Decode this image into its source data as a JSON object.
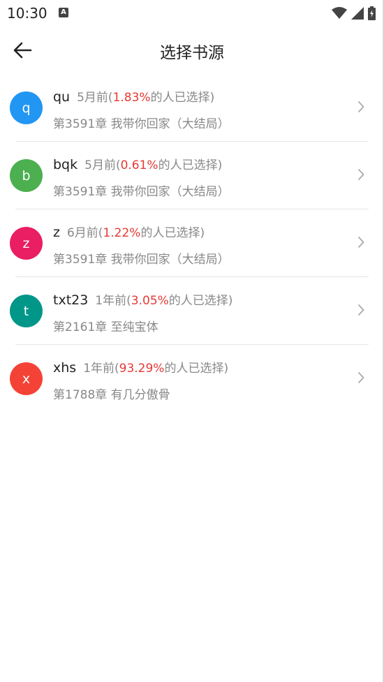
{
  "status_bar": {
    "time": "10:30",
    "notification_icon": "A"
  },
  "app_bar": {
    "title": "选择书源"
  },
  "sources": [
    {
      "letter": "q",
      "name": "qu",
      "age": "5月前(",
      "percent": "1.83%",
      "suffix": "的人已选择)",
      "chapter": "第3591章 我带你回家（大结局）",
      "avatar_color": "#2196f3"
    },
    {
      "letter": "b",
      "name": "bqk",
      "age": "5月前(",
      "percent": "0.61%",
      "suffix": "的人已选择)",
      "chapter": "第3591章 我带你回家（大结局）",
      "avatar_color": "#4caf50"
    },
    {
      "letter": "z",
      "name": "z",
      "age": "6月前(",
      "percent": "1.22%",
      "suffix": "的人已选择)",
      "chapter": "第3591章 我带你回家（大结局）",
      "avatar_color": "#e91e63"
    },
    {
      "letter": "t",
      "name": "txt23",
      "age": "1年前(",
      "percent": "3.05%",
      "suffix": "的人已选择)",
      "chapter": "第2161章 至纯宝体",
      "avatar_color": "#009688"
    },
    {
      "letter": "x",
      "name": "xhs",
      "age": "1年前(",
      "percent": "93.29%",
      "suffix": "的人已选择)",
      "chapter": "第1788章 有几分傲骨",
      "avatar_color": "#f44336"
    }
  ],
  "colors": {
    "percent": "#e53935",
    "secondary_text": "#888888",
    "primary_text": "#222222"
  }
}
